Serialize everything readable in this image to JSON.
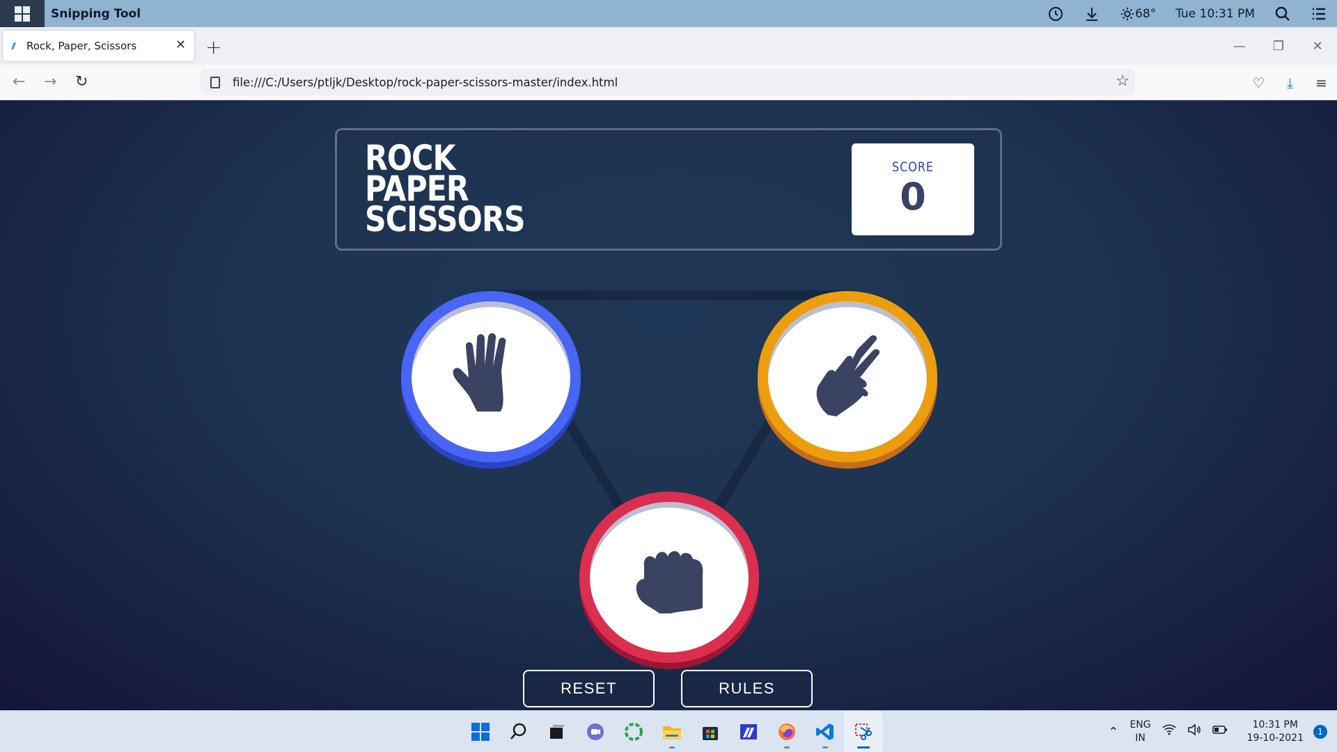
{
  "os_bar": {
    "app_title": "Snipping Tool",
    "weather": "68°",
    "clock": "Tue 10:31 PM"
  },
  "browser": {
    "tab_title": "Rock, Paper, Scissors",
    "tab_close": "✕",
    "new_tab": "+",
    "url": "file:///C:/Users/ptljk/Desktop/rock-paper-scissors-master/index.html"
  },
  "game": {
    "title_lines": [
      "ROCK",
      "PAPER",
      "SCISSORS"
    ],
    "score_label": "SCORE",
    "score_value": "0",
    "choices": [
      {
        "name": "paper",
        "ring_color": "#4865f4"
      },
      {
        "name": "scissors",
        "ring_color": "#ec9e0e"
      },
      {
        "name": "rock",
        "ring_color": "#dc2e4e"
      }
    ],
    "reset_label": "RESET",
    "rules_label": "RULES"
  },
  "taskbar": {
    "apps": [
      "start-icon",
      "search-icon",
      "task-view-icon",
      "teams-chat-icon",
      "app-icon-green",
      "file-explorer-icon",
      "store-icon",
      "app-icon-blue",
      "firefox-icon",
      "vscode-icon",
      "snipping-tool-icon"
    ],
    "lang_top": "ENG",
    "lang_bottom": "IN",
    "time": "10:31 PM",
    "date": "19-10-2021",
    "notification_count": "1"
  }
}
